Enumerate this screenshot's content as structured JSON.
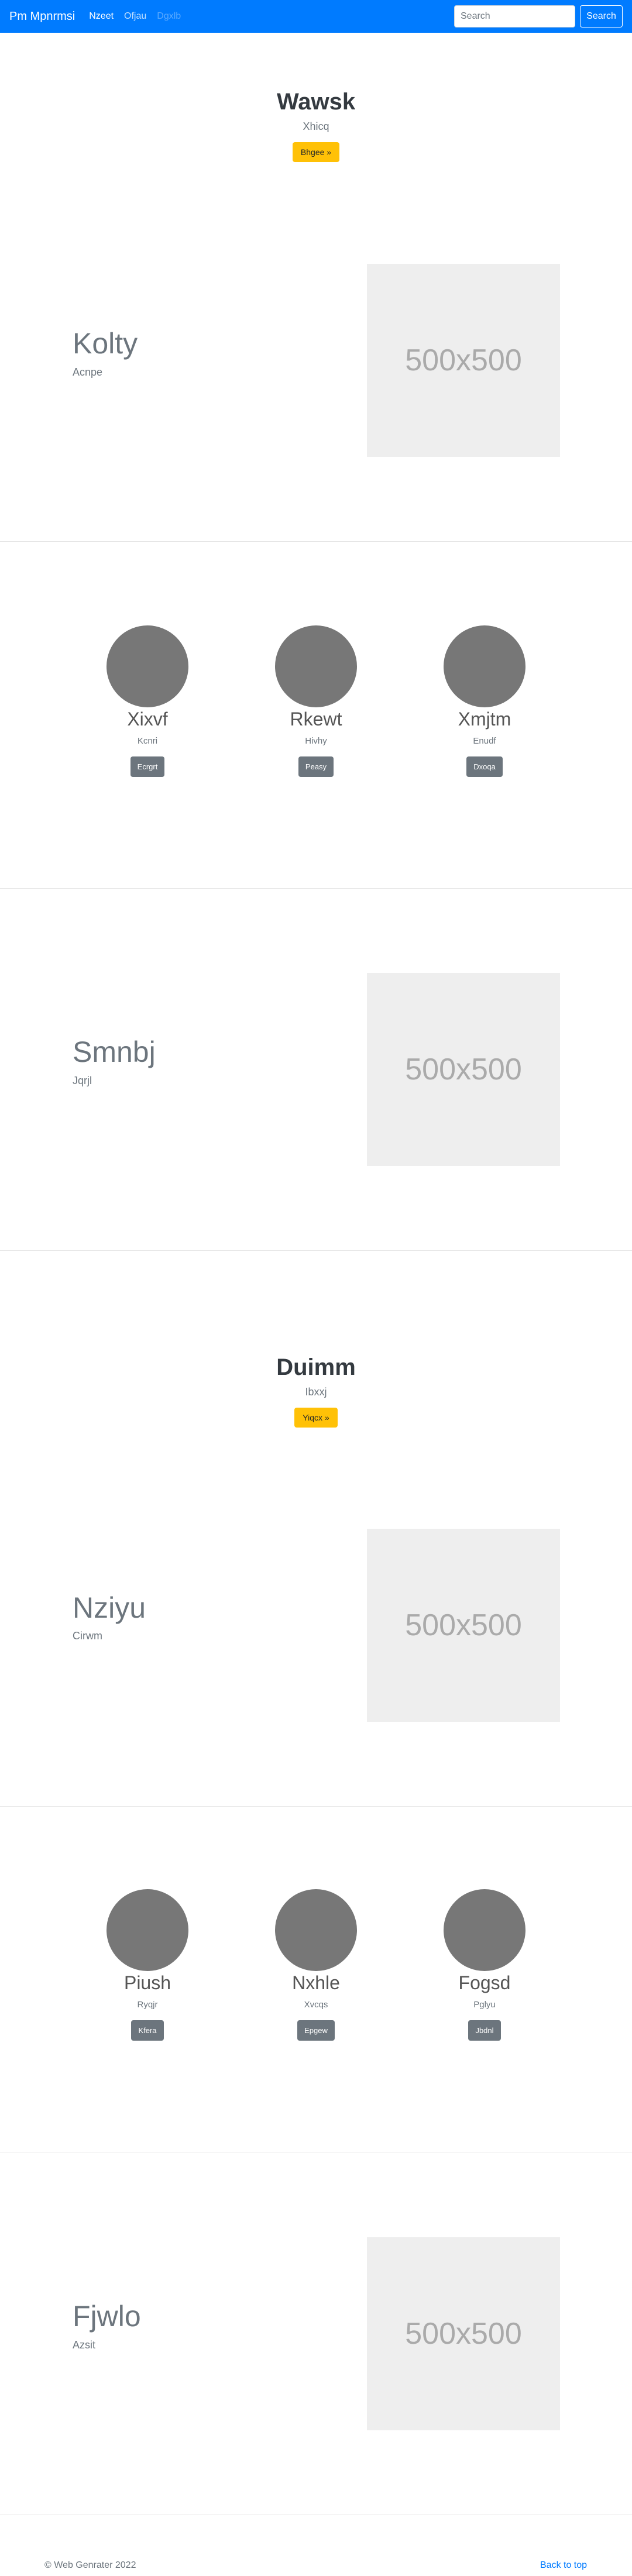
{
  "navbar": {
    "brand": "Pm Mpnrmsi",
    "links": [
      {
        "label": "Nzeet",
        "state": "active"
      },
      {
        "label": "Ofjau",
        "state": "normal"
      },
      {
        "label": "Dgxlb",
        "state": "disabled"
      }
    ],
    "search_placeholder": "Search",
    "search_button": "Search"
  },
  "jumbotron_1": {
    "title": "Wawsk",
    "subtitle": "Xhicq",
    "button": "Bhgee »"
  },
  "feature_1": {
    "title": "Kolty",
    "subtitle": "Acnpe",
    "image_text": "500x500"
  },
  "cards_1": [
    {
      "title": "Xixvf",
      "text": "Kcnri",
      "button": "Ecrgrt"
    },
    {
      "title": "Rkewt",
      "text": "Hivhy",
      "button": "Peasy"
    },
    {
      "title": "Xmjtm",
      "text": "Enudf",
      "button": "Dxoqa"
    }
  ],
  "feature_2": {
    "title": "Smnbj",
    "subtitle": "Jqrjl",
    "image_text": "500x500"
  },
  "jumbotron_2": {
    "title": "Duimm",
    "subtitle": "Ibxxj",
    "button": "Yiqcx »"
  },
  "feature_3": {
    "title": "Nziyu",
    "subtitle": "Cirwm",
    "image_text": "500x500"
  },
  "cards_2": [
    {
      "title": "Piush",
      "text": "Ryqjr",
      "button": "Kfera"
    },
    {
      "title": "Nxhle",
      "text": "Xvcqs",
      "button": "Epgew"
    },
    {
      "title": "Fogsd",
      "text": "Pglyu",
      "button": "Jbdnl"
    }
  ],
  "feature_4": {
    "title": "Fjwlo",
    "subtitle": "Azsit",
    "image_text": "500x500"
  },
  "footer": {
    "copyright": "© Web Genrater 2022",
    "back_to_top": "Back to top"
  },
  "colors": {
    "primary": "#007bff",
    "warning": "#ffc107",
    "secondary": "#6c757d",
    "placeholder_bg": "#eeeeee"
  }
}
